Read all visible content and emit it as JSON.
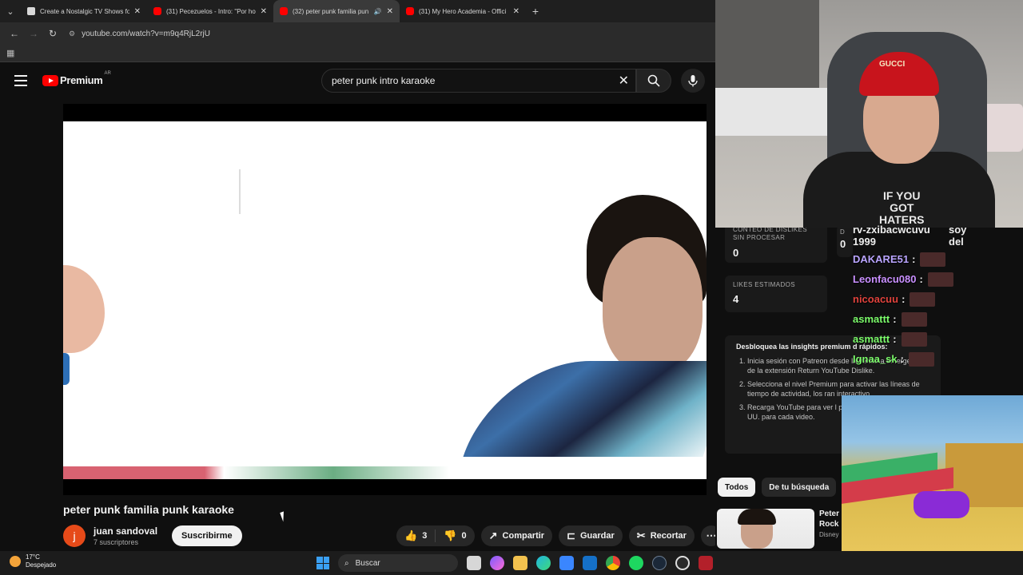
{
  "browser": {
    "tabs": [
      {
        "title": "Create a Nostalgic TV Shows fo",
        "favicon": "doc",
        "active": false
      },
      {
        "title": "(31) Pecezuelos - Intro: \"Por ho",
        "favicon": "yt",
        "active": false
      },
      {
        "title": "(32) peter punk familia pun",
        "favicon": "yt",
        "active": true
      },
      {
        "title": "(31) My Hero Academia - Offici",
        "favicon": "yt",
        "active": false
      }
    ],
    "url": "youtube.com/watch?v=m9q4RjL2rjU"
  },
  "youtube": {
    "brand": "Premium",
    "country": "AR",
    "search_value": "peter punk intro karaoke",
    "video_title": "peter punk familia punk karaoke",
    "channel": {
      "avatar_letter": "j",
      "name": "juan sandoval",
      "subscribers": "7 suscriptores",
      "subscribe_label": "Suscribirme"
    },
    "actions": {
      "likes": "3",
      "dislikes": "0",
      "share": "Compartir",
      "save": "Guardar",
      "clip": "Recortar"
    }
  },
  "sidebar": {
    "dislikes_label": "CONTEO DE DISLIKES SIN PROCESAR",
    "dislikes_value": "0",
    "likes_label": "LIKES ESTIMADOS",
    "likes_value": "4",
    "side_value": "0",
    "side_label": "D",
    "insights_title": "Desbloquea las insights premium d rápidos:",
    "insights_steps": [
      "Inicia sesión con Patreon desde la ventana emergente de la extensión Return YouTube Dislike.",
      "Selecciona el nivel Premium para activar las líneas de tiempo de actividad, los ran interactivo.",
      "Recarga YouTube para ver l países principales y el desg UU. para cada video."
    ],
    "chips": [
      "Todos",
      "De tu búsqueda"
    ],
    "rec": {
      "title_a": "Peter",
      "title_b": "Rock",
      "channel": "Disney"
    }
  },
  "stream_overlay": {
    "cap_text": "GUCCI",
    "shirt_text_a": "IF YOU",
    "shirt_text_b": "GOT",
    "shirt_text_c": "HATERS",
    "chat_top": "rv-zxibacwcuvu",
    "chat_top2": "1999",
    "chat_top_right": "soy del",
    "chat_users": [
      {
        "name": "DAKARE51",
        "color": "#b9a4ff"
      },
      {
        "name": "Leonfacu080",
        "color": "#c990ff"
      },
      {
        "name": "nicoacuu",
        "color": "#e0423c"
      },
      {
        "name": "asmattt",
        "color": "#7cfc6b"
      },
      {
        "name": "asmattt",
        "color": "#7cfc6b"
      },
      {
        "name": "Ignaa_sk",
        "color": "#7cfc6b"
      }
    ],
    "separator": ":"
  },
  "taskbar": {
    "temp": "17°C",
    "weather": "Despejado",
    "search_placeholder": "Buscar"
  },
  "colors": {
    "yt_red": "#ff0000",
    "bg": "#0f0f0f",
    "chip_bg": "#272727"
  }
}
